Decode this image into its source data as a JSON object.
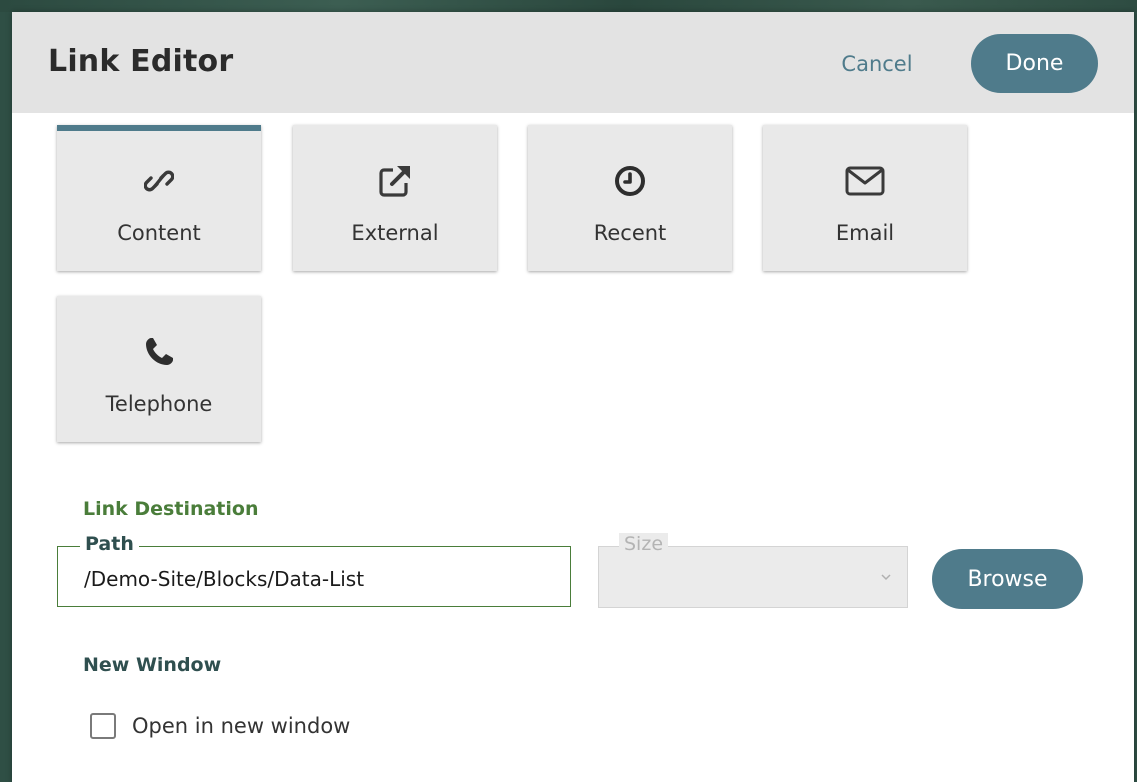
{
  "dialog": {
    "title": "Link Editor",
    "cancel_label": "Cancel",
    "done_label": "Done"
  },
  "tabs": [
    {
      "label": "Content",
      "icon": "link-icon",
      "active": true
    },
    {
      "label": "External",
      "icon": "external-link-icon",
      "active": false
    },
    {
      "label": "Recent",
      "icon": "clock-icon",
      "active": false
    },
    {
      "label": "Email",
      "icon": "envelope-icon",
      "active": false
    },
    {
      "label": "Telephone",
      "icon": "phone-icon",
      "active": false
    }
  ],
  "link_destination": {
    "section_label": "Link Destination",
    "path_label": "Path",
    "path_value": "/Demo-Site/Blocks/Data-List",
    "size_label": "Size",
    "size_value": "",
    "browse_label": "Browse"
  },
  "new_window": {
    "section_label": "New Window",
    "checkbox_label": "Open in new window",
    "checked": false
  },
  "colors": {
    "accent": "#4f7b8b",
    "section_green": "#4a7d3a",
    "header_bg": "#e3e3e3",
    "tile_bg": "#e9e9e9"
  }
}
